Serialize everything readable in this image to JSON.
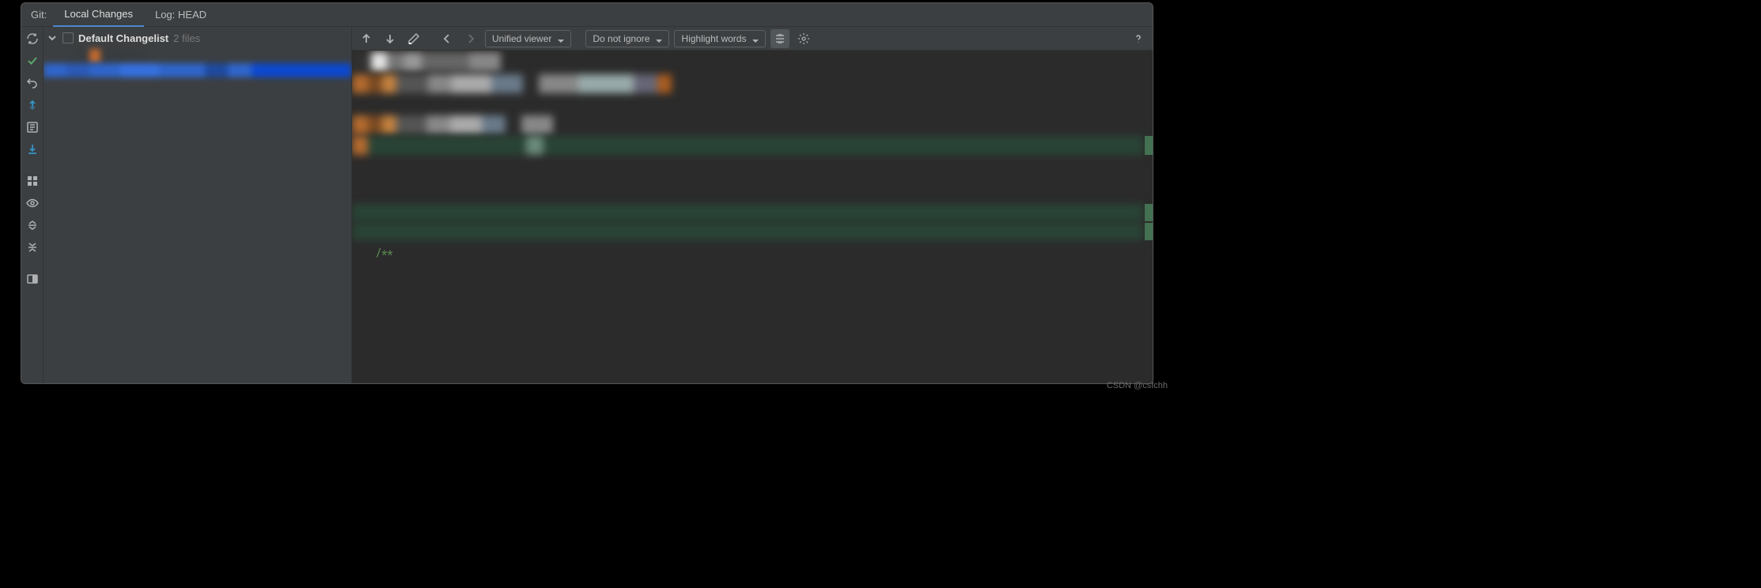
{
  "tabbar": {
    "prefix": "Git:",
    "tabs": [
      "Local Changes",
      "Log: HEAD"
    ],
    "activeIndex": 0
  },
  "changelist": {
    "name": "Default Changelist",
    "count": "2 files"
  },
  "diffToolbar": {
    "viewer": "Unified viewer",
    "ignore": "Do not ignore",
    "highlight": "Highlight words"
  },
  "diffBody": {
    "visibleCode": "/**"
  },
  "watermark": "CSDN @csfchh"
}
